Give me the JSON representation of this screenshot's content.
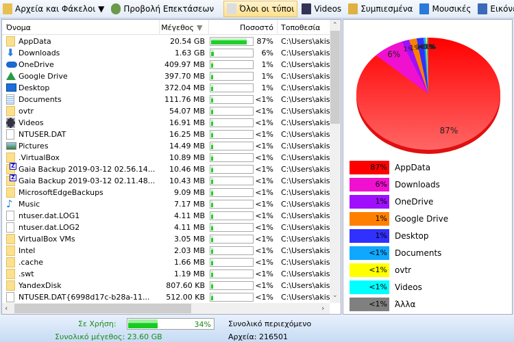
{
  "toolbar": {
    "items": [
      {
        "label": "Αρχεία και Φάκελοι ▼",
        "icon": "folder-files-icon"
      },
      {
        "label": "Προβολή Επεκτάσεων",
        "icon": "extensions-icon"
      },
      {
        "label": "Όλοι οι τύποι",
        "icon": "all-types-icon",
        "active": true
      },
      {
        "label": "Videos",
        "icon": "film-icon"
      },
      {
        "label": "Συμπιεσμένα",
        "icon": "archive-icon"
      },
      {
        "label": "Μουσικές",
        "icon": "music-icon"
      },
      {
        "label": "Εικόνες",
        "icon": "image-icon"
      }
    ],
    "overflow": "⯯"
  },
  "table": {
    "columns": [
      "Όνομα",
      "Μέγεθος",
      "Ποσοστό",
      "Τοποθεσία"
    ],
    "sort_icon": "▼",
    "rows": [
      {
        "name": "AppData",
        "size": "20.54 GB",
        "pct": "87%",
        "fill": 87,
        "loc": "C:\\Users\\akist",
        "icon": "folder"
      },
      {
        "name": "Downloads",
        "size": "1.63 GB",
        "pct": "6%",
        "fill": 6,
        "loc": "C:\\Users\\akist",
        "icon": "download"
      },
      {
        "name": "OneDrive",
        "size": "409.97 MB",
        "pct": "1%",
        "fill": 1.7,
        "loc": "C:\\Users\\akist",
        "icon": "cloud"
      },
      {
        "name": "Google Drive",
        "size": "397.70 MB",
        "pct": "1%",
        "fill": 1.7,
        "loc": "C:\\Users\\akist",
        "icon": "gdrive"
      },
      {
        "name": "Desktop",
        "size": "372.04 MB",
        "pct": "1%",
        "fill": 1.6,
        "loc": "C:\\Users\\akist",
        "icon": "desktop"
      },
      {
        "name": "Documents",
        "size": "111.76 MB",
        "pct": "<1%",
        "fill": 0.5,
        "loc": "C:\\Users\\akist",
        "icon": "document"
      },
      {
        "name": "ovtr",
        "size": "54.07 MB",
        "pct": "<1%",
        "fill": 0.2,
        "loc": "C:\\Users\\akist",
        "icon": "folder"
      },
      {
        "name": "Videos",
        "size": "16.91 MB",
        "pct": "<1%",
        "fill": 0.1,
        "loc": "C:\\Users\\akist",
        "icon": "film"
      },
      {
        "name": "NTUSER.DAT",
        "size": "16.25 MB",
        "pct": "<1%",
        "fill": 0.1,
        "loc": "C:\\Users\\akist",
        "icon": "file"
      },
      {
        "name": "Pictures",
        "size": "14.49 MB",
        "pct": "<1%",
        "fill": 0.1,
        "loc": "C:\\Users\\akist",
        "icon": "image"
      },
      {
        "name": ".VirtualBox",
        "size": "10.89 MB",
        "pct": "<1%",
        "fill": 0,
        "loc": "C:\\Users\\akist",
        "icon": "folder"
      },
      {
        "name": "Gaia Backup 2019-03-12 02.56.14...",
        "size": "10.46 MB",
        "pct": "<1%",
        "fill": 0,
        "loc": "C:\\Users\\akist",
        "icon": "zip"
      },
      {
        "name": "Gaia Backup 2019-03-12 02.11.48...",
        "size": "10.43 MB",
        "pct": "<1%",
        "fill": 0,
        "loc": "C:\\Users\\akist",
        "icon": "zip"
      },
      {
        "name": "MicrosoftEdgeBackups",
        "size": "9.09 MB",
        "pct": "<1%",
        "fill": 0,
        "loc": "C:\\Users\\akist",
        "icon": "folder"
      },
      {
        "name": "Music",
        "size": "7.17 MB",
        "pct": "<1%",
        "fill": 0,
        "loc": "C:\\Users\\akist",
        "icon": "music"
      },
      {
        "name": "ntuser.dat.LOG1",
        "size": "4.11 MB",
        "pct": "<1%",
        "fill": 0,
        "loc": "C:\\Users\\akist",
        "icon": "file"
      },
      {
        "name": "ntuser.dat.LOG2",
        "size": "4.11 MB",
        "pct": "<1%",
        "fill": 0,
        "loc": "C:\\Users\\akist",
        "icon": "file"
      },
      {
        "name": "VirtualBox VMs",
        "size": "3.05 MB",
        "pct": "<1%",
        "fill": 0,
        "loc": "C:\\Users\\akist",
        "icon": "folder"
      },
      {
        "name": "Intel",
        "size": "2.03 MB",
        "pct": "<1%",
        "fill": 0,
        "loc": "C:\\Users\\akist",
        "icon": "folder"
      },
      {
        "name": ".cache",
        "size": "1.66 MB",
        "pct": "<1%",
        "fill": 0,
        "loc": "C:\\Users\\akist",
        "icon": "folder"
      },
      {
        "name": ".swt",
        "size": "1.19 MB",
        "pct": "<1%",
        "fill": 0,
        "loc": "C:\\Users\\akist",
        "icon": "folder"
      },
      {
        "name": "YandexDisk",
        "size": "807.60 KB",
        "pct": "<1%",
        "fill": 0,
        "loc": "C:\\Users\\akist",
        "icon": "folder"
      },
      {
        "name": "NTUSER.DAT{6998d17c-b28a-11...",
        "size": "512.00 KB",
        "pct": "<1%",
        "fill": 0,
        "loc": "C:\\Users\\akist",
        "icon": "file"
      }
    ]
  },
  "chart_data": {
    "type": "pie",
    "style": "3d",
    "slices": [
      {
        "name": "AppData",
        "value": 20.54,
        "label": "87%",
        "color": "#ff0000"
      },
      {
        "name": "Downloads",
        "value": 1.63,
        "label": "6%",
        "color": "#f010d0"
      },
      {
        "name": "OneDrive",
        "value": 0.41,
        "label": "1%",
        "color": "#a010ff"
      },
      {
        "name": "Google Drive",
        "value": 0.398,
        "label": "1%",
        "color": "#ff8000"
      },
      {
        "name": "Desktop",
        "value": 0.372,
        "label": "1%",
        "color": "#3030ff"
      },
      {
        "name": "Documents",
        "value": 0.112,
        "label": "<1%",
        "color": "#10a8ff"
      },
      {
        "name": "ovtr",
        "value": 0.054,
        "label": "<1%",
        "color": "#ffff00"
      },
      {
        "name": "Videos",
        "value": 0.017,
        "label": "<1%",
        "color": "#00ffff"
      },
      {
        "name": "Άλλα",
        "value": 0.067,
        "label": "<1%",
        "color": "#808080"
      }
    ]
  },
  "status": {
    "used_label": "Σε Χρήση:",
    "used_pct": "34%",
    "used_fill": 34,
    "total_size": "Συνολικό μέγεθος: 23.60 GB",
    "content_label": "Συνολικό περιεχόμενο",
    "files": "Αρχεία: 216501"
  }
}
